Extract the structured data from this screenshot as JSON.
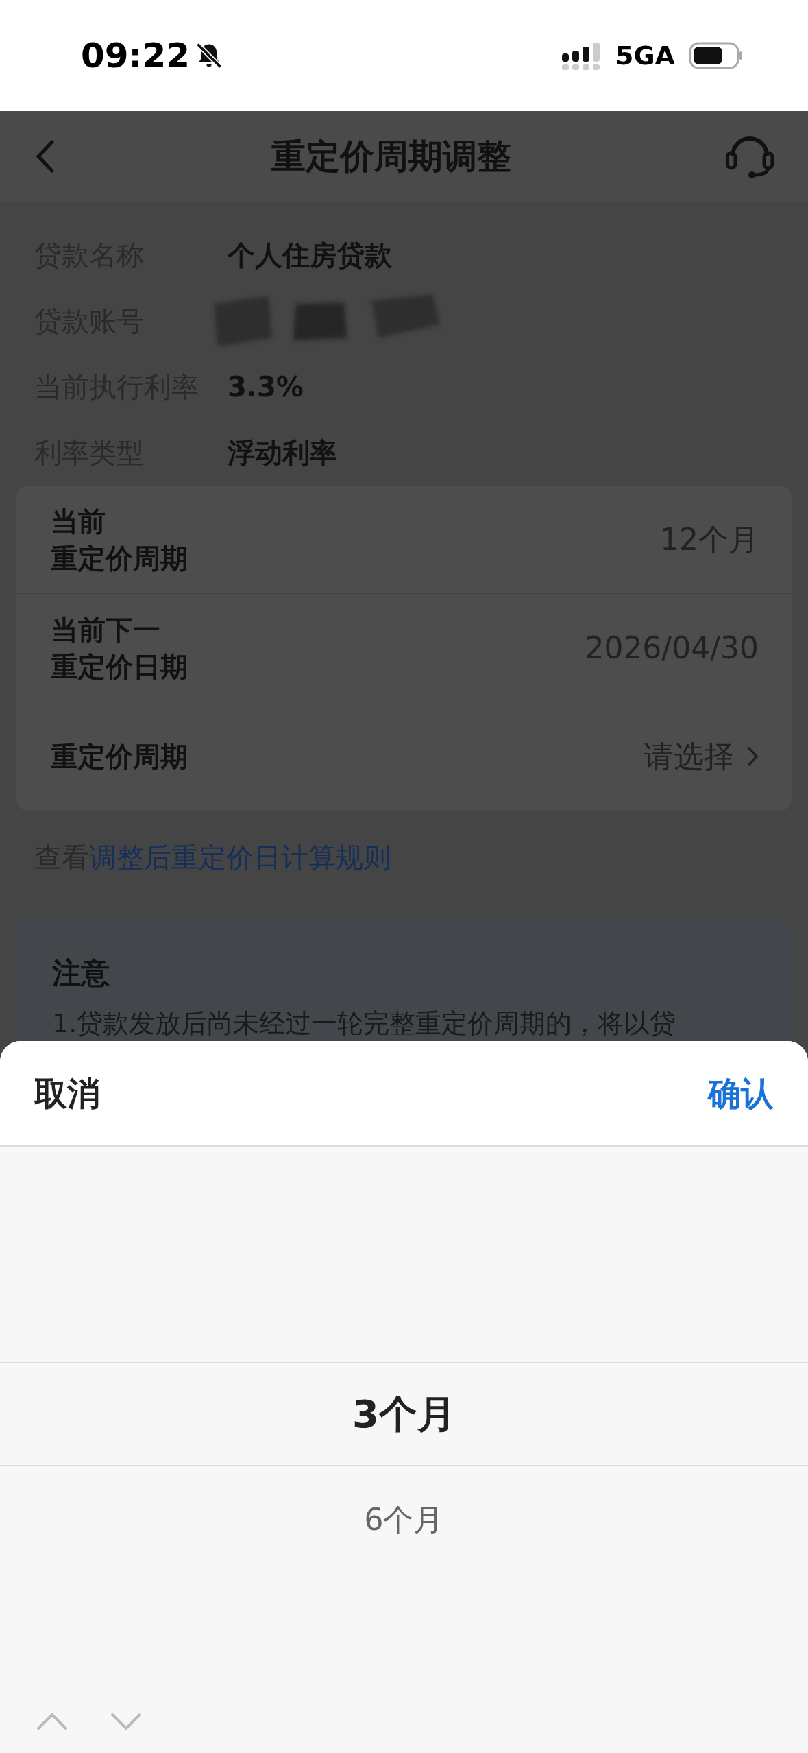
{
  "status_bar": {
    "time": "09:22",
    "network": "5GA"
  },
  "header": {
    "title": "重定价周期调整"
  },
  "info": [
    {
      "label": "贷款名称",
      "value": "个人住房贷款",
      "kind": "text"
    },
    {
      "label": "贷款账号",
      "kind": "redacted"
    },
    {
      "label": "当前执行利率",
      "value": "3.3%",
      "kind": "text"
    },
    {
      "label": "利率类型",
      "value": "浮动利率",
      "kind": "text"
    }
  ],
  "card_rows": [
    {
      "label_lines": [
        "当前",
        "重定价周期"
      ],
      "value": "12个月",
      "kind": "value"
    },
    {
      "label_lines": [
        "当前下一",
        "重定价日期"
      ],
      "value": "2026/04/30",
      "kind": "value"
    },
    {
      "label_lines": [
        "重定价周期"
      ],
      "value": "请选择",
      "kind": "select"
    }
  ],
  "rule_link": {
    "prefix": "查看",
    "link": "调整后重定价日计算规则"
  },
  "notice": {
    "title": "注意",
    "text": "1.贷款发放后尚未经过一轮完整重定价周期的，将以贷"
  },
  "sheet": {
    "cancel": "取消",
    "confirm": "确认",
    "options": [
      {
        "label": "3个月",
        "selected": true
      },
      {
        "label": "6个月",
        "selected": false
      }
    ]
  }
}
